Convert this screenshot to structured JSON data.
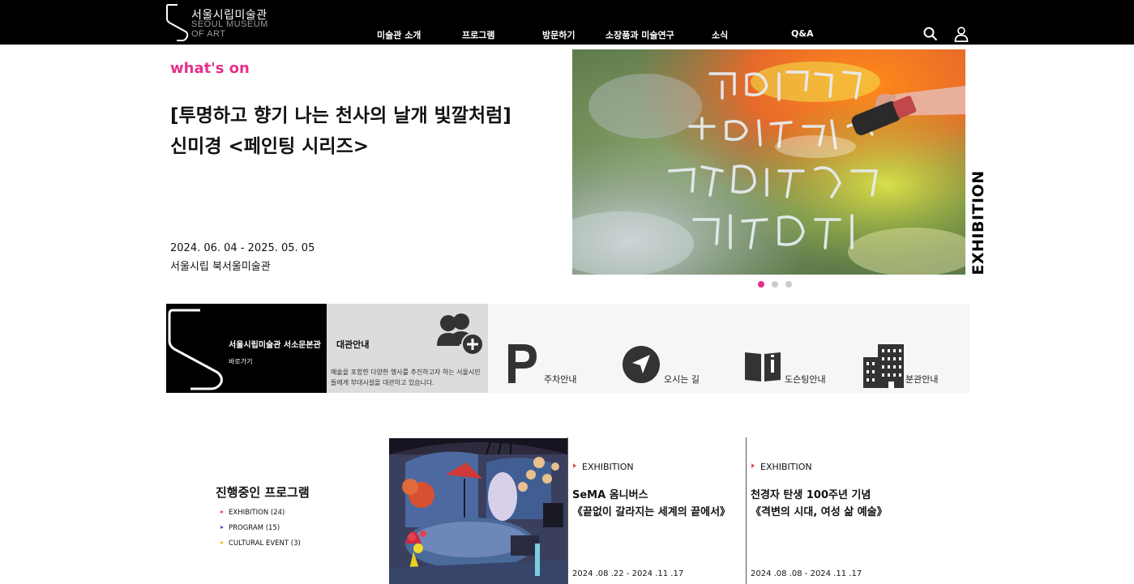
{
  "header": {
    "logo_kr": "서울시립미술관",
    "logo_en_line1": "SEOUL MUSEUM",
    "logo_en_line2": "OF ART",
    "nav": [
      "미술관 소개",
      "프로그램",
      "방문하기",
      "소장품과 미술연구",
      "소식",
      "Q&A"
    ],
    "icons": [
      "search-icon",
      "user-icon"
    ]
  },
  "hero": {
    "label": "what's on",
    "title_line1": "[투명하고 향기 나는 천사의 날개 빛깔처럼]",
    "title_line2": "신미경 <페인팅 시리즈>",
    "date": "2024. 06. 04 - 2025. 05. 05",
    "venue": "서울시립 북서울미술관",
    "side_label": "EXHIBITION",
    "slides_total": 3,
    "slide_active": 1,
    "image_text": "투명하고 향기 나는 천사의 날개 빛깔처럼"
  },
  "quicklinks": {
    "seoso_title": "서울시립미술관 서소문본관",
    "seoso_sub": "바로가기",
    "rental_title": "대관안내",
    "rental_desc": "예술을 포함한 다양한 행사를 추진하고자 하는 서울시민들에게 부대시설을 대관하고 있습니다.",
    "items": [
      {
        "label": "주차안내",
        "icon": "parking-icon"
      },
      {
        "label": "오시는 길",
        "icon": "direction-icon"
      },
      {
        "label": "도슨팅안내",
        "icon": "docent-book-icon"
      },
      {
        "label": "분관안내",
        "icon": "building-icon"
      }
    ]
  },
  "programs": {
    "title": "진행중인 프로그램",
    "categories": [
      {
        "label": "EXHIBITION (24)",
        "color": "#e05050"
      },
      {
        "label": "PROGRAM (15)",
        "color": "#4a4ad8"
      },
      {
        "label": "CULTURAL EVENT (3)",
        "color": "#e8c020"
      }
    ],
    "cards": [
      {
        "category": "EXHIBITION",
        "title_line1": "SeMA 옴니버스",
        "title_line2": "《끝없이 갈라지는 세계의 끝에서》",
        "date": "2024 .08 .22 - 2024 .11 .17"
      },
      {
        "category": "EXHIBITION",
        "title_line1": "천경자 탄생 100주년 기념",
        "title_line2": "《격변의 시대, 여성 삶 예술》",
        "date": "2024 .08 .08 - 2024 .11 .17"
      }
    ]
  },
  "colors": {
    "accent": "#e5308c",
    "header_bg": "#000000"
  }
}
